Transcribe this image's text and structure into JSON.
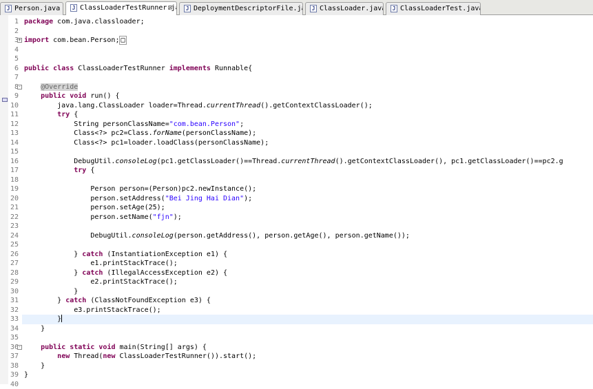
{
  "tabs": [
    {
      "label": "Person.java",
      "active": false
    },
    {
      "label": "ClassLoaderTestRunner.java",
      "active": true,
      "close": "⊠"
    },
    {
      "label": "DeploymentDescriptorFile.java",
      "active": false
    },
    {
      "label": "ClassLoader.java",
      "active": false
    },
    {
      "label": "ClassLoaderTest.java",
      "active": false
    }
  ],
  "tab_icon_letter": "J",
  "fold_markers": {
    "3": "+",
    "8": "-",
    "36": "-"
  },
  "caret_line": 33,
  "lines": [
    [
      [
        "package",
        "kw"
      ],
      [
        " com.java.classloader;",
        ""
      ]
    ],
    [],
    [
      [
        "import",
        "kw"
      ],
      [
        " com.bean.Person;",
        ""
      ],
      [
        "□",
        "fbox"
      ]
    ],
    [],
    [],
    [
      [
        "public",
        "kw"
      ],
      [
        " ",
        ""
      ],
      [
        "class",
        "kw"
      ],
      [
        " ClassLoaderTestRunner ",
        ""
      ],
      [
        "implements",
        "kw"
      ],
      [
        " Runnable{",
        ""
      ]
    ],
    [],
    [
      [
        "    ",
        ""
      ],
      [
        "@Override",
        "ann"
      ]
    ],
    [
      [
        "    ",
        ""
      ],
      [
        "public",
        "kw"
      ],
      [
        " ",
        ""
      ],
      [
        "void",
        "kw"
      ],
      [
        " run() {",
        ""
      ]
    ],
    [
      [
        "        java.lang.ClassLoader loader=Thread.",
        ""
      ],
      [
        "currentThread",
        "it"
      ],
      [
        "().getContextClassLoader();",
        ""
      ]
    ],
    [
      [
        "        ",
        ""
      ],
      [
        "try",
        "kw"
      ],
      [
        " {",
        ""
      ]
    ],
    [
      [
        "            String personClassName=",
        ""
      ],
      [
        "\"com.bean.Person\"",
        "str"
      ],
      [
        ";",
        ""
      ]
    ],
    [
      [
        "            Class<?> pc2=Class.",
        ""
      ],
      [
        "forName",
        "it"
      ],
      [
        "(personClassName);",
        ""
      ]
    ],
    [
      [
        "            Class<?> pc1=loader.loadClass(personClassName);",
        ""
      ]
    ],
    [],
    [
      [
        "            DebugUtil.",
        ""
      ],
      [
        "consoleLog",
        "it"
      ],
      [
        "(pc1.getClassLoader()==Thread.",
        ""
      ],
      [
        "currentThread",
        "it"
      ],
      [
        "().getContextClassLoader(), pc1.getClassLoader()==pc2.g",
        ""
      ]
    ],
    [
      [
        "            ",
        ""
      ],
      [
        "try",
        "kw"
      ],
      [
        " {",
        ""
      ]
    ],
    [],
    [
      [
        "                Person person=(Person)pc2.newInstance();",
        ""
      ]
    ],
    [
      [
        "                person.setAddress(",
        ""
      ],
      [
        "\"Bei Jing Hai Dian\"",
        "str"
      ],
      [
        ");",
        ""
      ]
    ],
    [
      [
        "                person.setAge(25);",
        ""
      ]
    ],
    [
      [
        "                person.setName(",
        ""
      ],
      [
        "\"fjn\"",
        "str"
      ],
      [
        ");",
        ""
      ]
    ],
    [],
    [
      [
        "                DebugUtil.",
        ""
      ],
      [
        "consoleLog",
        "it"
      ],
      [
        "(person.getAddress(), person.getAge(), person.getName());",
        ""
      ]
    ],
    [],
    [
      [
        "            } ",
        ""
      ],
      [
        "catch",
        "kw"
      ],
      [
        " (InstantiationException e1) {",
        ""
      ]
    ],
    [
      [
        "                e1.printStackTrace();",
        ""
      ]
    ],
    [
      [
        "            } ",
        ""
      ],
      [
        "catch",
        "kw"
      ],
      [
        " (IllegalAccessException e2) {",
        ""
      ]
    ],
    [
      [
        "                e2.printStackTrace();",
        ""
      ]
    ],
    [
      [
        "            }",
        ""
      ]
    ],
    [
      [
        "        } ",
        ""
      ],
      [
        "catch",
        "kw"
      ],
      [
        " (ClassNotFoundException e3) {",
        ""
      ]
    ],
    [
      [
        "            e3.printStackTrace();",
        ""
      ]
    ],
    [
      [
        "        }",
        ""
      ]
    ],
    [
      [
        "    }",
        ""
      ]
    ],
    [],
    [
      [
        "    ",
        ""
      ],
      [
        "public",
        "kw"
      ],
      [
        " ",
        ""
      ],
      [
        "static",
        "kw"
      ],
      [
        " ",
        ""
      ],
      [
        "void",
        "kw"
      ],
      [
        " main(String[] args) {",
        ""
      ]
    ],
    [
      [
        "        ",
        ""
      ],
      [
        "new",
        "kw"
      ],
      [
        " Thread(",
        ""
      ],
      [
        "new",
        "kw"
      ],
      [
        " ClassLoaderTestRunner()).start();",
        ""
      ]
    ],
    [
      [
        "    }",
        ""
      ]
    ],
    [
      [
        "}",
        ""
      ]
    ],
    []
  ]
}
